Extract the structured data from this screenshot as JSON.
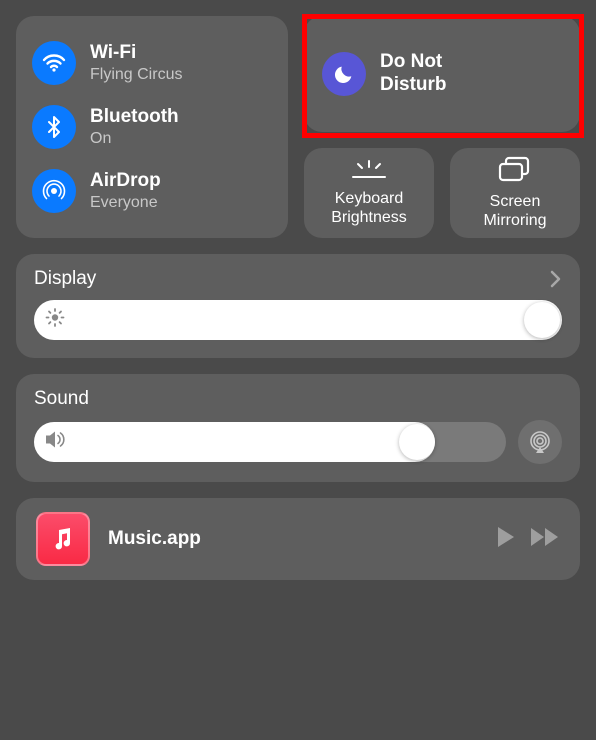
{
  "connectivity": {
    "wifi": {
      "title": "Wi-Fi",
      "sub": "Flying Circus"
    },
    "bluetooth": {
      "title": "Bluetooth",
      "sub": "On"
    },
    "airdrop": {
      "title": "AirDrop",
      "sub": "Everyone"
    }
  },
  "dnd": {
    "line1": "Do Not",
    "line2": "Disturb"
  },
  "keyboard_brightness": {
    "line1": "Keyboard",
    "line2": "Brightness"
  },
  "screen_mirroring": {
    "line1": "Screen",
    "line2": "Mirroring"
  },
  "display": {
    "title": "Display",
    "value_percent": 100
  },
  "sound": {
    "title": "Sound",
    "value_percent": 80
  },
  "now_playing": {
    "app": "Music.app"
  }
}
